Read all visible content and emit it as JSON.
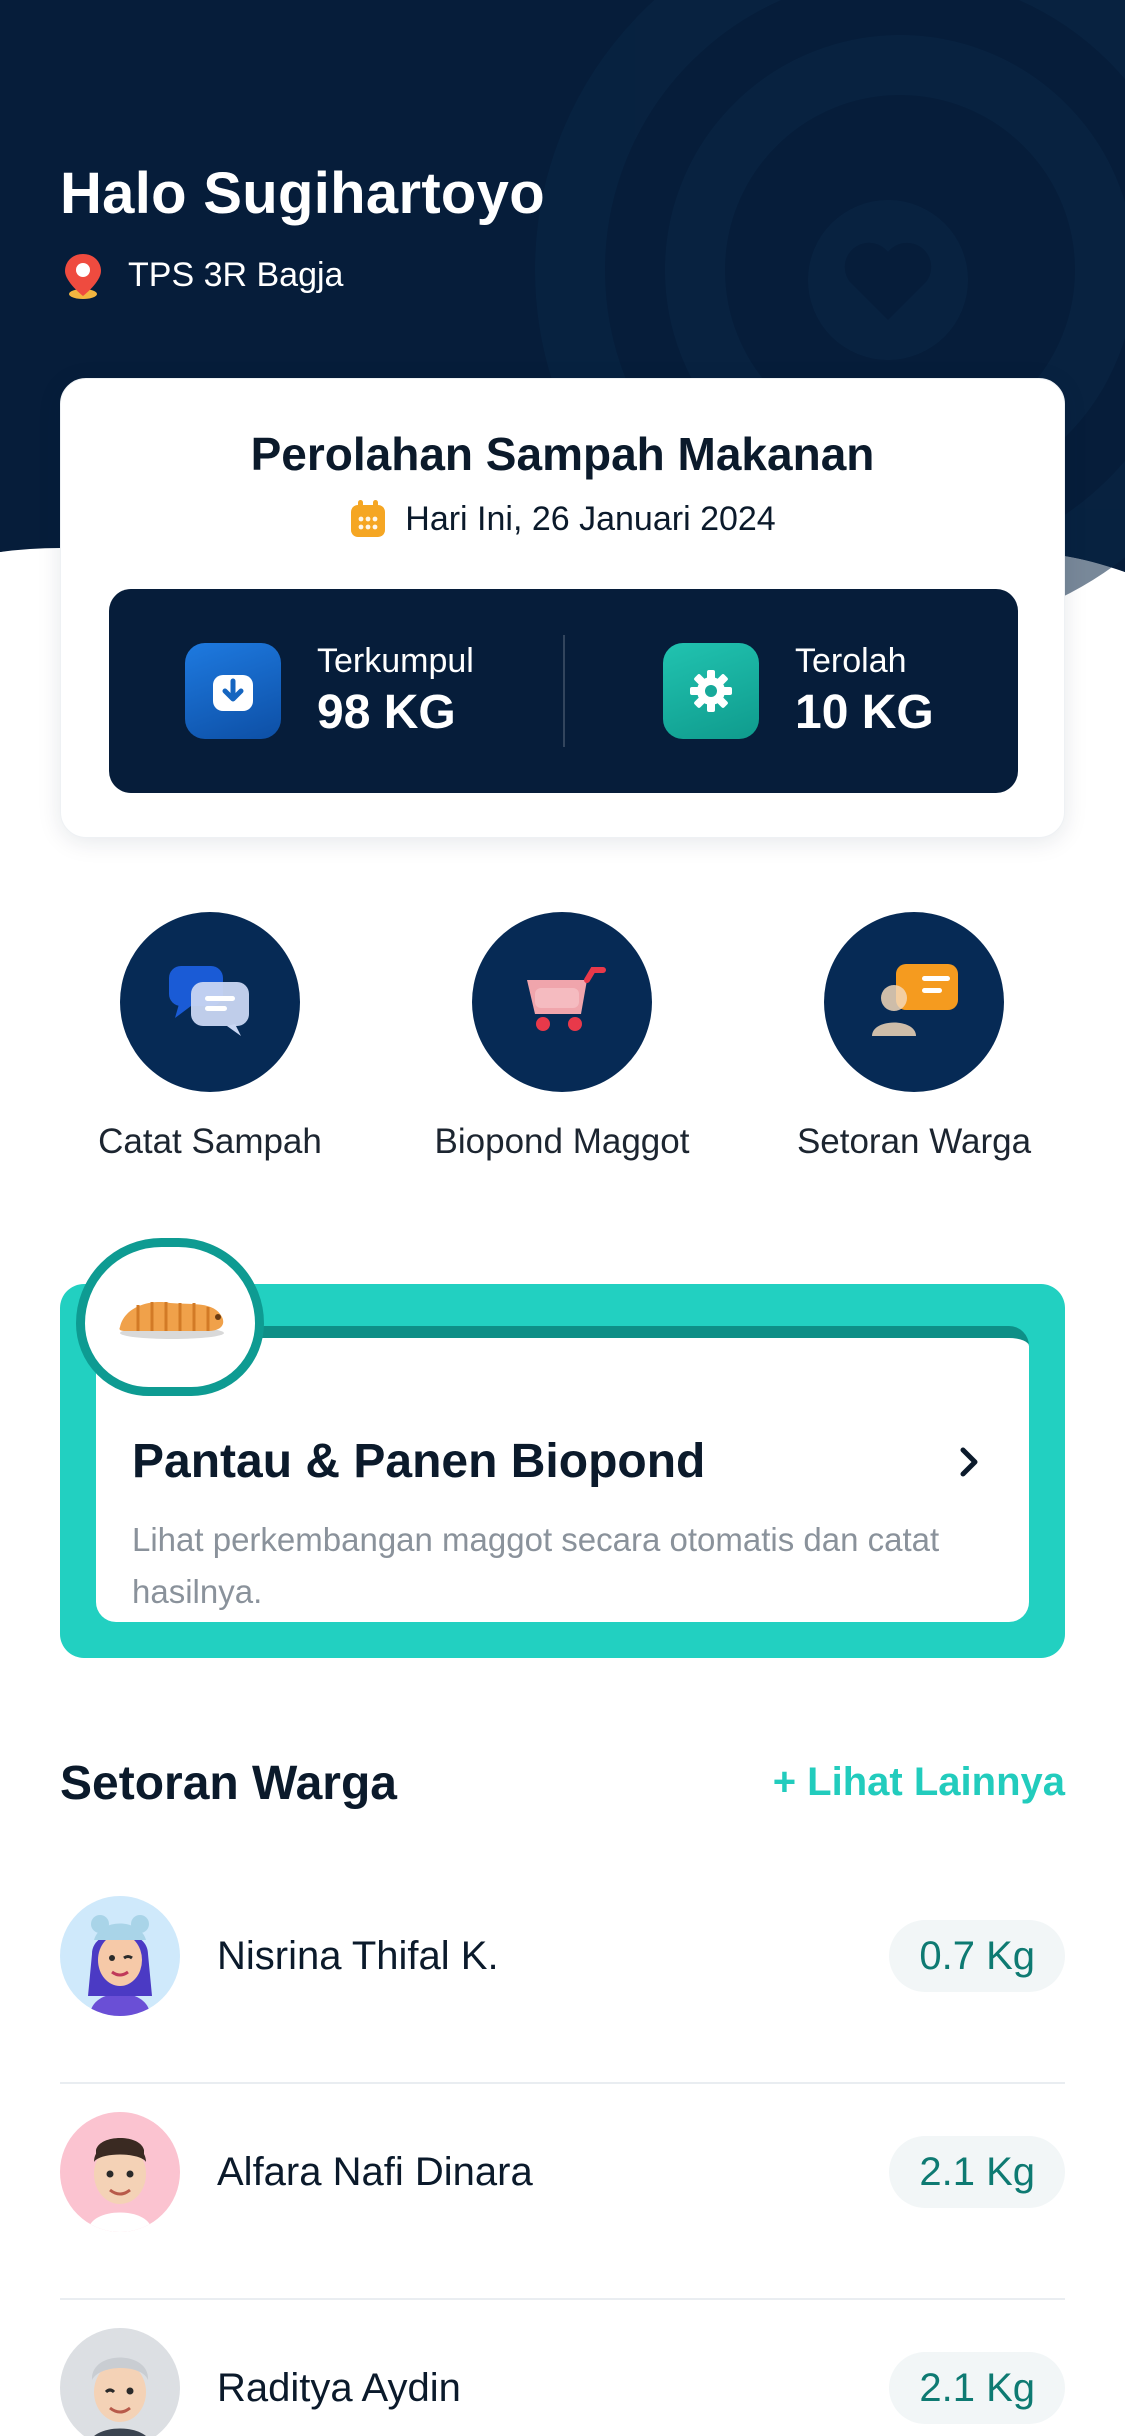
{
  "header": {
    "greeting": "Halo Sugihartoyo",
    "location": "TPS 3R Bagja",
    "bg_color": "#061d3a"
  },
  "summary_card": {
    "title": "Perolahan Sampah Makanan",
    "date": "Hari Ini, 26 Januari 2024",
    "stats": [
      {
        "label": "Terkumpul",
        "value": "98 KG",
        "icon": "download-icon",
        "color": "#1565c0"
      },
      {
        "label": "Terolah",
        "value": "10 KG",
        "icon": "gear-icon",
        "color": "#16a99a"
      }
    ]
  },
  "menu": [
    {
      "label": "Catat Sampah",
      "icon": "chat-bubbles-icon"
    },
    {
      "label": "Biopond Maggot",
      "icon": "cart-icon"
    },
    {
      "label": "Setoran Warga",
      "icon": "id-card-icon"
    }
  ],
  "promo": {
    "title": "Pantau & Panen Biopond",
    "description": "Lihat perkembangan maggot secara otomatis dan catat hasilnya.",
    "icon": "larva-icon"
  },
  "deposits": {
    "title": "Setoran Warga",
    "more_label": "+ Lihat Lainnya",
    "items": [
      {
        "name": "Nisrina Thifal K.",
        "amount": "0.7 Kg",
        "avatar_bg": "#cfe9fb"
      },
      {
        "name": "Alfara Nafi Dinara",
        "amount": "2.1 Kg",
        "avatar_bg": "#fbc3d0"
      },
      {
        "name": "Raditya Aydin",
        "amount": "2.1 Kg",
        "avatar_bg": "#dcdfe3"
      }
    ]
  }
}
